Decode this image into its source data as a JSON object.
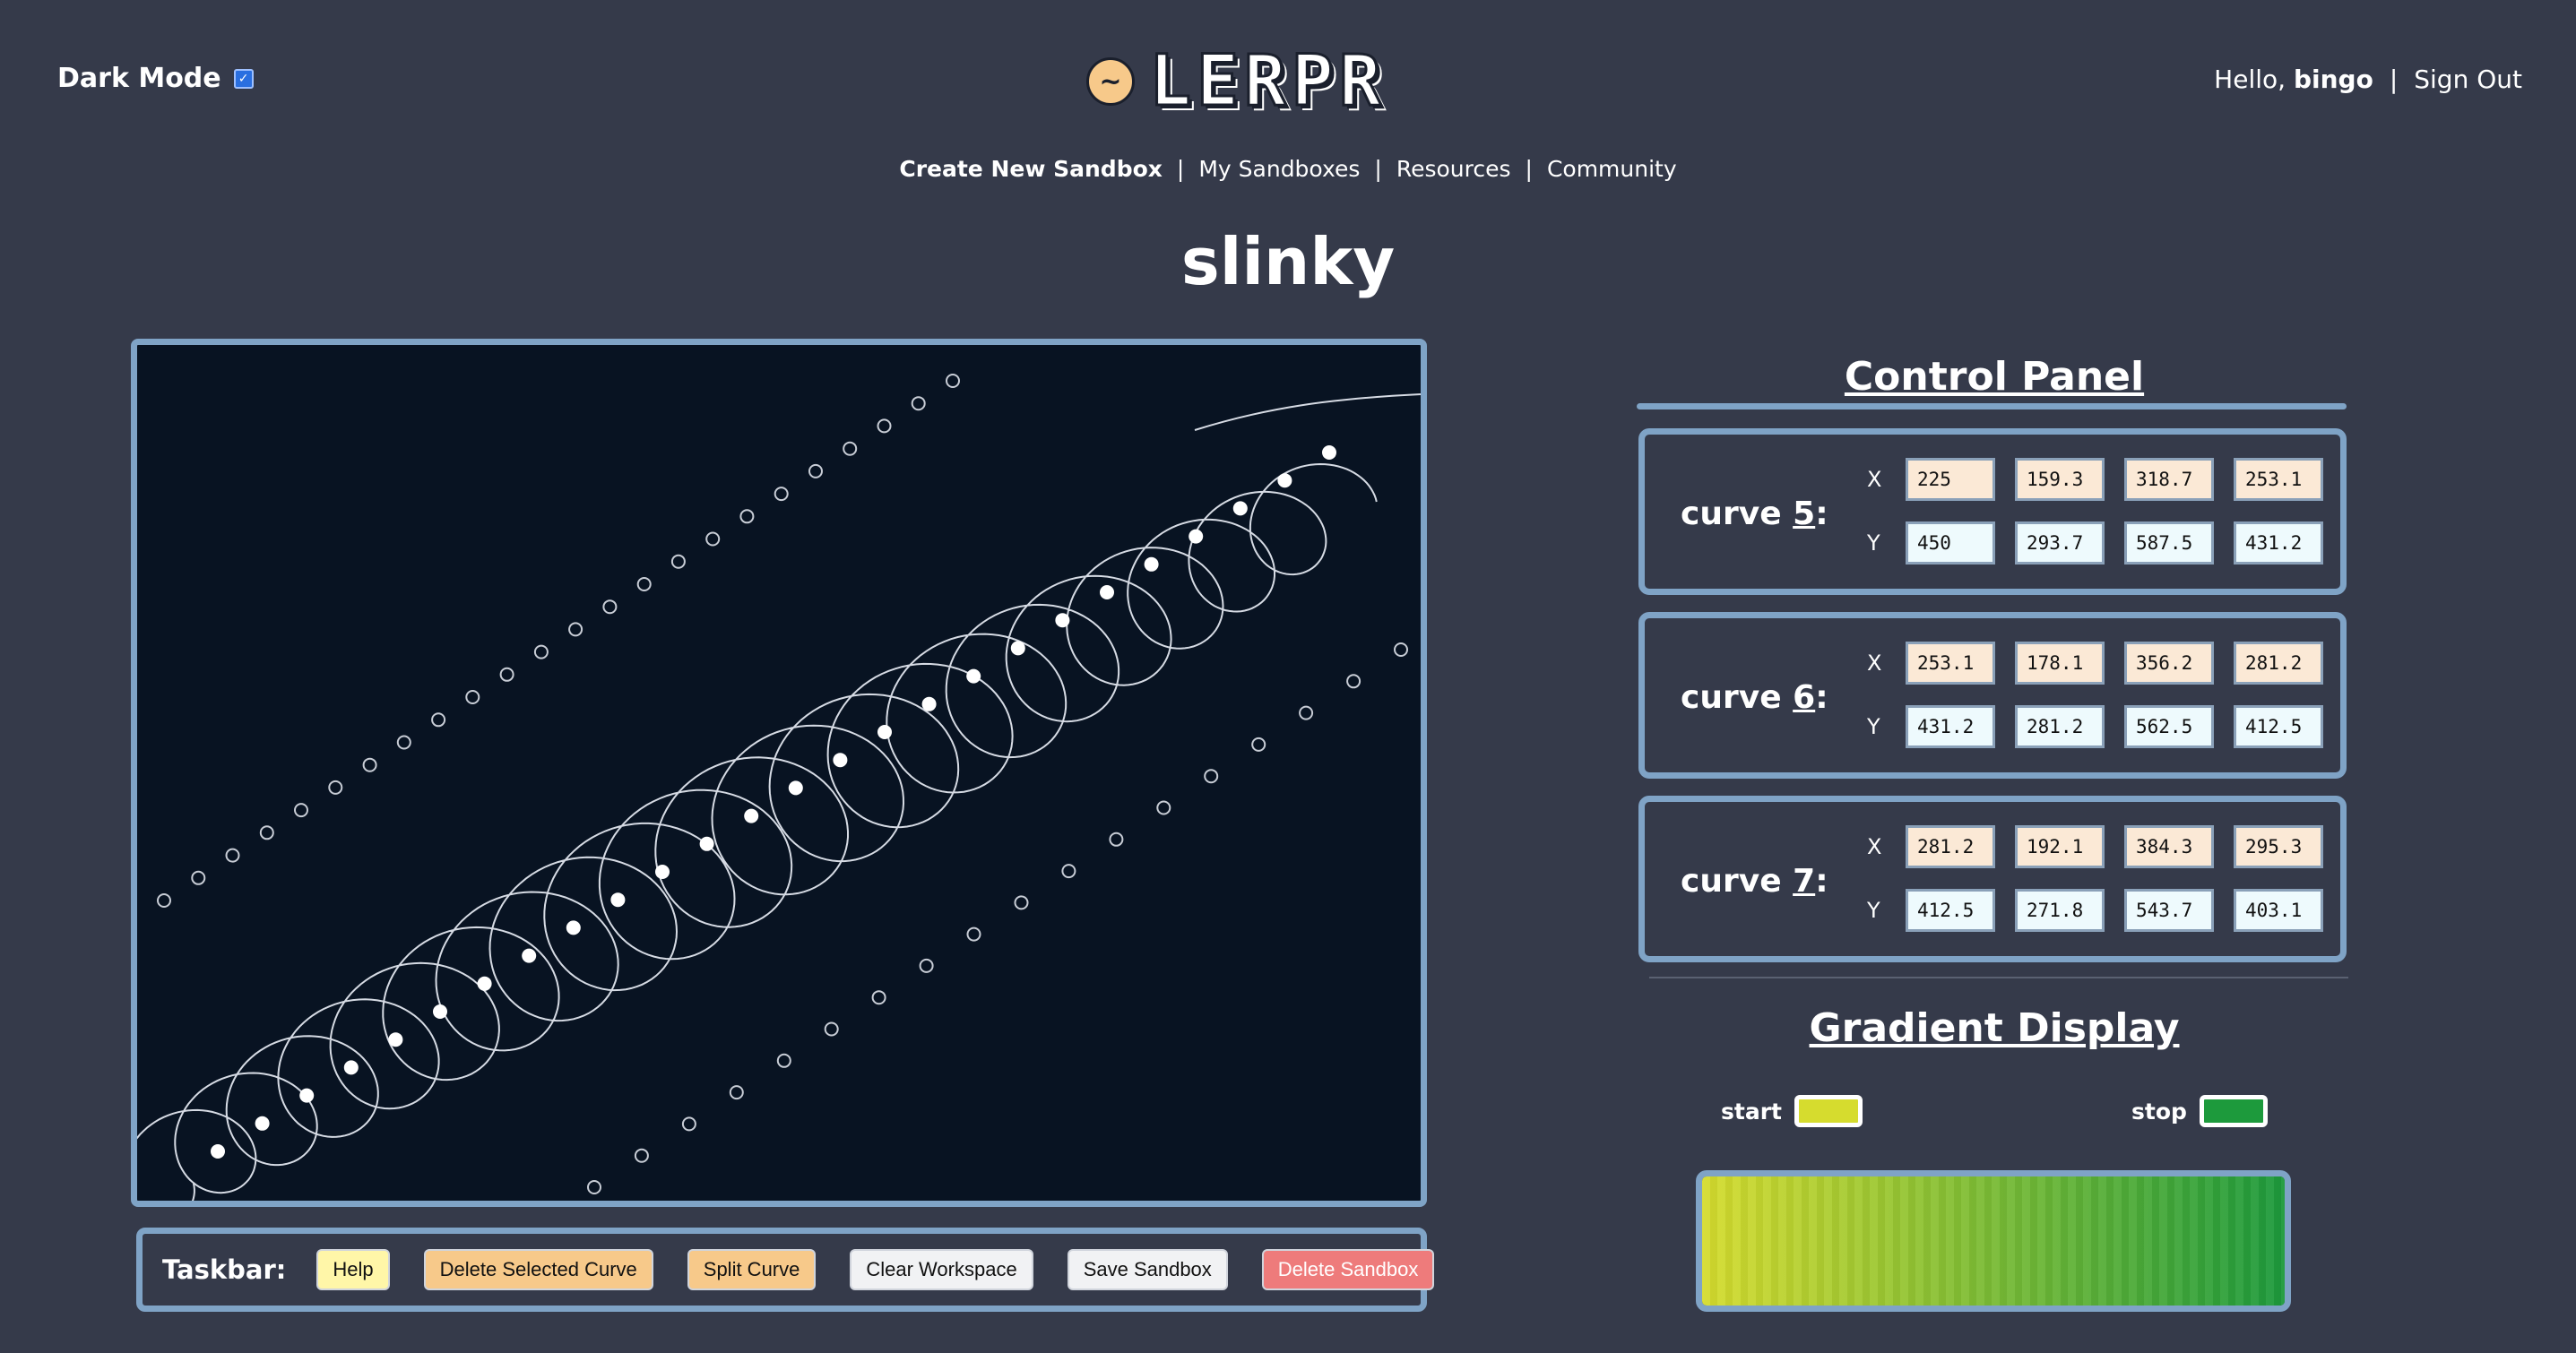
{
  "header": {
    "dark_mode_label": "Dark Mode",
    "dark_mode_checked": true,
    "logo_text": "LERPR",
    "logo_icon": "sine-wave-icon",
    "greeting": "Hello,",
    "username": "bingo",
    "sign_out": "Sign Out"
  },
  "nav": {
    "items": [
      "Create New Sandbox",
      "My Sandboxes",
      "Resources",
      "Community"
    ]
  },
  "sandbox": {
    "title": "slinky"
  },
  "taskbar": {
    "label": "Taskbar:",
    "buttons": [
      {
        "label": "Help",
        "color": "#fff6a8"
      },
      {
        "label": "Delete Selected Curve",
        "color": "#f7c98a"
      },
      {
        "label": "Split Curve",
        "color": "#f7c98a"
      },
      {
        "label": "Clear Workspace",
        "color": "#f1f2f4"
      },
      {
        "label": "Save Sandbox",
        "color": "#f1f2f4"
      },
      {
        "label": "Delete Sandbox",
        "color": "#ee7b7b"
      }
    ]
  },
  "control_panel": {
    "title": "Control Panel",
    "curves": [
      {
        "prefix": "curve ",
        "number": "5",
        "suffix": ":",
        "x": [
          "225",
          "159.3",
          "318.7",
          "253.1"
        ],
        "y": [
          "450",
          "293.7",
          "587.5",
          "431.2"
        ]
      },
      {
        "prefix": "curve ",
        "number": "6",
        "suffix": ":",
        "x": [
          "253.1",
          "178.1",
          "356.2",
          "281.2"
        ],
        "y": [
          "431.2",
          "281.2",
          "562.5",
          "412.5"
        ]
      },
      {
        "prefix": "curve ",
        "number": "7",
        "suffix": ":",
        "x": [
          "281.2",
          "192.1",
          "384.3",
          "295.3"
        ],
        "y": [
          "412.5",
          "271.8",
          "543.7",
          "403.1"
        ]
      }
    ],
    "axis_x": "X",
    "axis_y": "Y"
  },
  "gradient": {
    "title": "Gradient Display",
    "start_label": "start",
    "stop_label": "stop",
    "start_color": "#d6dc2e",
    "stop_color": "#1d9a3c"
  },
  "colors": {
    "background": "#353a4a",
    "canvas": "#081322",
    "border": "#7fa3c6"
  }
}
